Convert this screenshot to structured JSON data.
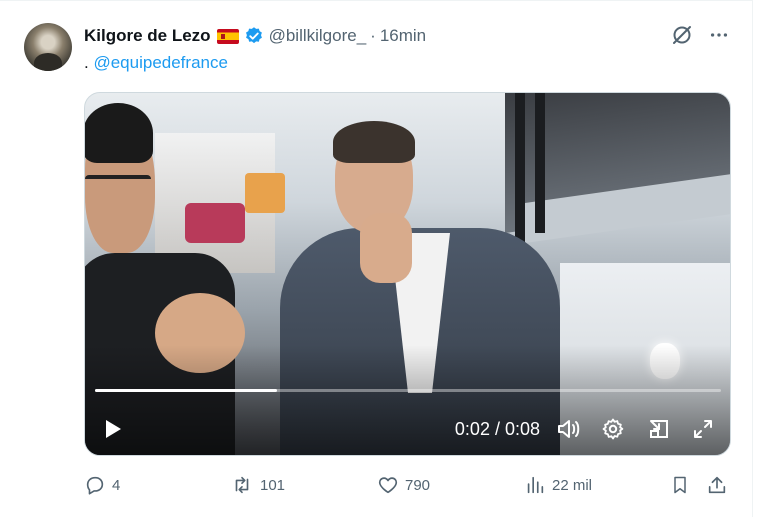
{
  "tweet": {
    "author_name": "Kilgore de Lezo",
    "handle": "@billkilgore_",
    "separator": "·",
    "time": "16min",
    "text_prefix": ".",
    "mention": "@equipedefrance"
  },
  "video": {
    "time_display": "0:02 / 0:08",
    "progress": 0.29
  },
  "actions": {
    "replies": "4",
    "reposts": "101",
    "likes": "790",
    "views": "22 mil"
  },
  "colors": {
    "accent": "#1d9bf0",
    "muted": "#536471"
  }
}
